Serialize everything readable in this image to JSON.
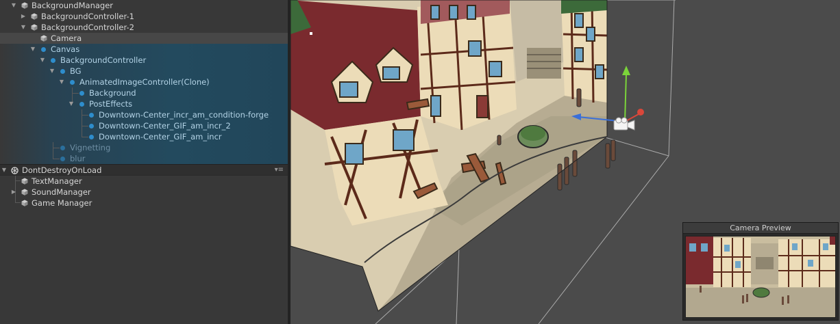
{
  "hierarchy": {
    "items": [
      {
        "label": "BackgroundManager"
      },
      {
        "label": "BackgroundController-1"
      },
      {
        "label": "BackgroundController-2"
      },
      {
        "label": "Camera"
      },
      {
        "label": "Canvas"
      },
      {
        "label": "BackgroundController"
      },
      {
        "label": "BG"
      },
      {
        "label": "AnimatedImageController(Clone)"
      },
      {
        "label": "Background"
      },
      {
        "label": "PostEffects"
      },
      {
        "label": "Downtown-Center_incr_am_condition-forge"
      },
      {
        "label": "Downtown-Center_GIF_am_incr_2"
      },
      {
        "label": "Downtown-Center_GIF_am_incr"
      },
      {
        "label": "Vignetting"
      },
      {
        "label": "blur"
      }
    ],
    "scene2": {
      "label": "DontDestroyOnLoad",
      "items": [
        {
          "label": "TextManager"
        },
        {
          "label": "SoundManager"
        },
        {
          "label": "Game Manager"
        }
      ]
    }
  },
  "camera_preview": {
    "title": "Camera Preview"
  },
  "colors": {
    "accent": "#2e8dcc",
    "selection": "#234a5e",
    "gizmo_y": "#7bd43a",
    "gizmo_x": "#d9473a",
    "gizmo_z": "#3a6fd9"
  },
  "icons": [
    "cube-icon",
    "unity-scene-icon",
    "camera-gizmo-icon"
  ]
}
